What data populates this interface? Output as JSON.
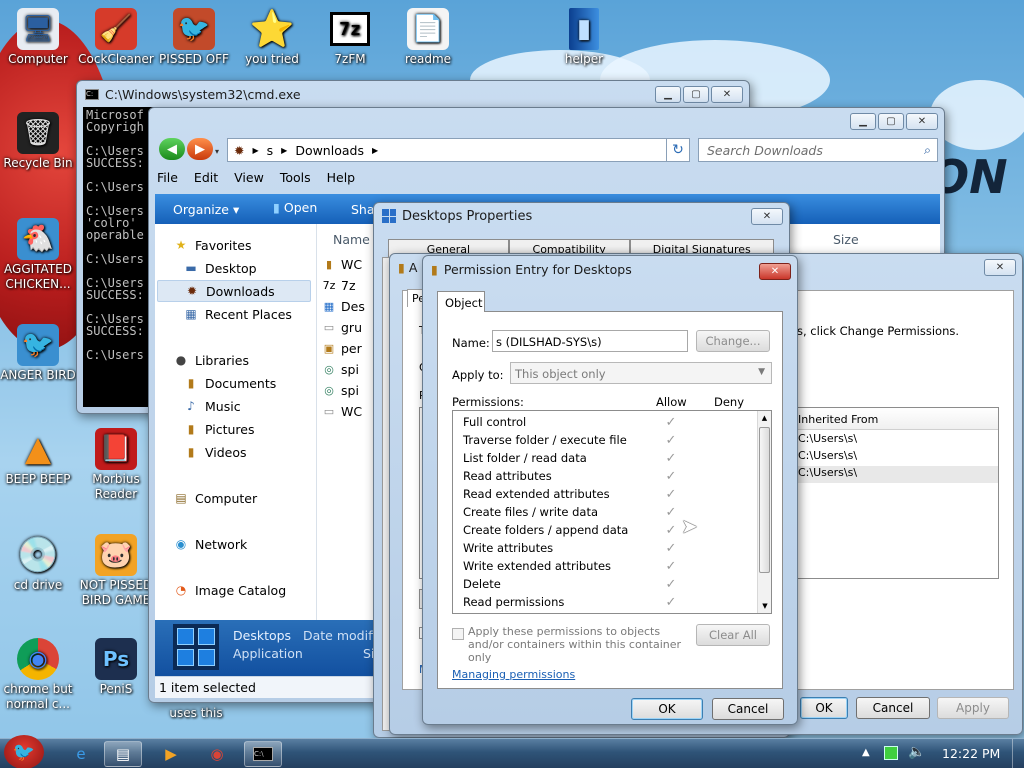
{
  "desktop": {
    "icons": [
      {
        "label": "Computer",
        "glyph": "🖥"
      },
      {
        "label": "CockCleaner",
        "glyph": "🧹"
      },
      {
        "label": "PISSED OFF",
        "glyph": "🐦"
      },
      {
        "label": "you tried",
        "glyph": "⭐"
      },
      {
        "label": "7zFM",
        "glyph": "7z"
      },
      {
        "label": "readme",
        "glyph": "📄"
      },
      {
        "label": "helper",
        "glyph": "▮"
      },
      {
        "label": "Recycle Bin",
        "glyph": "🗑"
      },
      {
        "label": "AGGITATED CHICKEN...",
        "glyph": "🐔"
      },
      {
        "label": "ANGER BIRD",
        "glyph": "🐦"
      },
      {
        "label": "BEEP BEEP",
        "glyph": "▲"
      },
      {
        "label": "Morbius Reader",
        "glyph": "📕"
      },
      {
        "label": "cd drive",
        "glyph": "💿"
      },
      {
        "label": "NOT PISSED BIRD GAME",
        "glyph": "🐷"
      },
      {
        "label": "chrome but normal c...",
        "glyph": "◉"
      },
      {
        "label": "PeniS",
        "glyph": "Ps"
      },
      {
        "label": "uses this",
        "glyph": ""
      }
    ]
  },
  "cmd": {
    "title": "C:\\Windows\\system32\\cmd.exe",
    "lines": [
      "Microsof",
      "Copyrigh",
      "",
      "C:\\Users",
      "SUCCESS:",
      "",
      "C:\\Users",
      "",
      "C:\\Users",
      "'colro'",
      "operable",
      "",
      "C:\\Users",
      "",
      "C:\\Users",
      "SUCCESS:",
      "",
      "C:\\Users",
      "SUCCESS:",
      "",
      "C:\\Users"
    ]
  },
  "explorer": {
    "path": [
      "s",
      "Downloads"
    ],
    "search_placeholder": "Search Downloads",
    "menu": [
      "File",
      "Edit",
      "View",
      "Tools",
      "Help"
    ],
    "toolbar": {
      "organize": "Organize",
      "open": "Open",
      "share": "Sha"
    },
    "nav": {
      "favorites": "Favorites",
      "desktop": "Desktop",
      "downloads": "Downloads",
      "recent": "Recent Places",
      "libraries": "Libraries",
      "documents": "Documents",
      "music": "Music",
      "pictures": "Pictures",
      "videos": "Videos",
      "computer": "Computer",
      "network": "Network",
      "catalog": "Image Catalog"
    },
    "column_name": "Name",
    "column_size": "Size",
    "files": [
      "WC",
      "7z",
      "Des",
      "gru",
      "per",
      "spi",
      "spi",
      "WC"
    ],
    "details": {
      "name": "Desktops",
      "type": "Application",
      "date_label": "Date modifi",
      "size_label": "Si"
    },
    "status": "1 item selected"
  },
  "desktop_props": {
    "title": "Desktops Properties",
    "tabs": [
      "General",
      "Compatibility",
      "Digital Signatures"
    ]
  },
  "adv_security": {
    "title": "A",
    "tab": "Pe",
    "change_text": "s, click Change Permissions.",
    "col_inherited": "Inherited From",
    "rows": [
      "C:\\Users\\s\\",
      "C:\\Users\\s\\",
      "C:\\Users\\s\\"
    ],
    "ok": "OK",
    "cancel": "Cancel",
    "apply": "Apply",
    "partial_labels": [
      "T",
      "O",
      "P",
      "M"
    ]
  },
  "perm_entry": {
    "title": "Permission Entry for Desktops",
    "tab": "Object",
    "name_label": "Name:",
    "name_value": "s (DILSHAD-SYS\\s)",
    "change_button": "Change...",
    "apply_to_label": "Apply to:",
    "apply_to_value": "This object only",
    "permissions_label": "Permissions:",
    "allow_label": "Allow",
    "deny_label": "Deny",
    "permissions": [
      "Full control",
      "Traverse folder / execute file",
      "List folder / read data",
      "Read attributes",
      "Read extended attributes",
      "Create files / write data",
      "Create folders / append data",
      "Write attributes",
      "Write extended attributes",
      "Delete",
      "Read permissions"
    ],
    "apply_children_label": "Apply these permissions to objects and/or containers within this container only",
    "clear_all": "Clear All",
    "managing_link": "Managing permissions",
    "ok": "OK",
    "cancel": "Cancel"
  },
  "taskbar": {
    "time": "12:22 PM"
  }
}
